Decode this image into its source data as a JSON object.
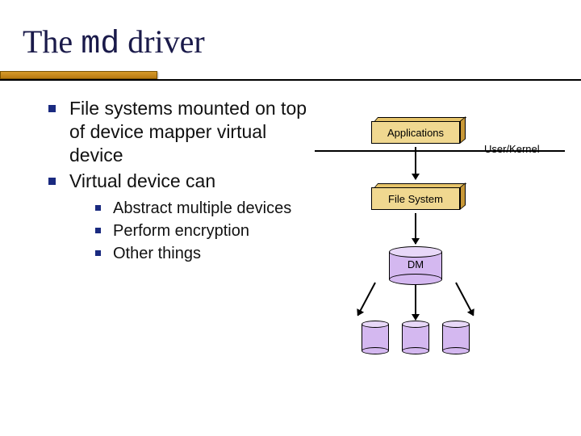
{
  "title": {
    "pre": "The ",
    "code": "md",
    "post": " driver"
  },
  "bullets": {
    "main": [
      "File systems mounted on top of device mapper virtual device",
      "Virtual device can"
    ],
    "sub": [
      "Abstract multiple devices",
      "Perform encryption",
      "Other things"
    ]
  },
  "diagram": {
    "applications": "Applications",
    "filesystem": "File System",
    "dm": "DM",
    "user_kernel": "User/Kernel"
  }
}
